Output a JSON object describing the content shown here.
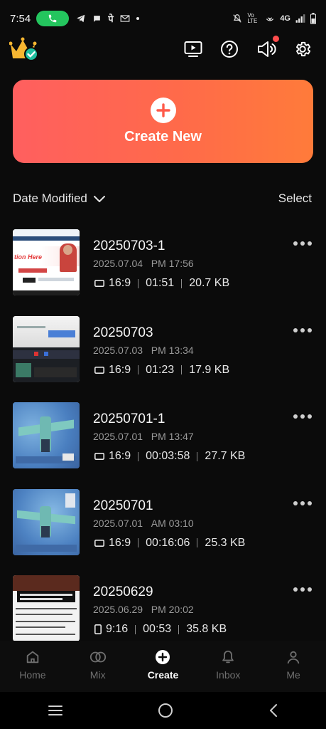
{
  "status_bar": {
    "time": "7:54",
    "network": "4G",
    "carrier_tag": "Vo LTE"
  },
  "toolbar": {
    "icons": [
      "premium-crown-icon",
      "tv-play-icon",
      "help-icon",
      "announcement-icon",
      "settings-gear-icon"
    ]
  },
  "create": {
    "label": "Create New"
  },
  "sort": {
    "label": "Date Modified",
    "select_label": "Select"
  },
  "projects": [
    {
      "name": "20250703-1",
      "date": "2025.07.04",
      "time": "PM 17:56",
      "ratio": "16:9",
      "duration": "01:51",
      "size": "20.7 KB"
    },
    {
      "name": "20250703",
      "date": "2025.07.03",
      "time": "PM 13:34",
      "ratio": "16:9",
      "duration": "01:23",
      "size": "17.9 KB"
    },
    {
      "name": "20250701-1",
      "date": "2025.07.01",
      "time": "PM 13:47",
      "ratio": "16:9",
      "duration": "00:03:58",
      "size": "27.7 KB"
    },
    {
      "name": "20250701",
      "date": "2025.07.01",
      "time": "AM 03:10",
      "ratio": "16:9",
      "duration": "00:16:06",
      "size": "25.3 KB"
    },
    {
      "name": "20250629",
      "date": "2025.06.29",
      "time": "PM 20:02",
      "ratio": "9:16",
      "duration": "00:53",
      "size": "35.8 KB"
    }
  ],
  "thumbnails": {
    "first_caption": "tion Here"
  },
  "bottom_nav": [
    {
      "label": "Home",
      "icon": "home-icon",
      "active": false
    },
    {
      "label": "Mix",
      "icon": "mix-icon",
      "active": false
    },
    {
      "label": "Create",
      "icon": "create-plus-icon",
      "active": true
    },
    {
      "label": "Inbox",
      "icon": "bell-icon",
      "active": false
    },
    {
      "label": "Me",
      "icon": "person-icon",
      "active": false
    }
  ],
  "colors": {
    "accent_start": "#ff5f5f",
    "accent_end": "#ff7b3a",
    "background": "#0b0b0b",
    "call_pill": "#24c55e"
  }
}
